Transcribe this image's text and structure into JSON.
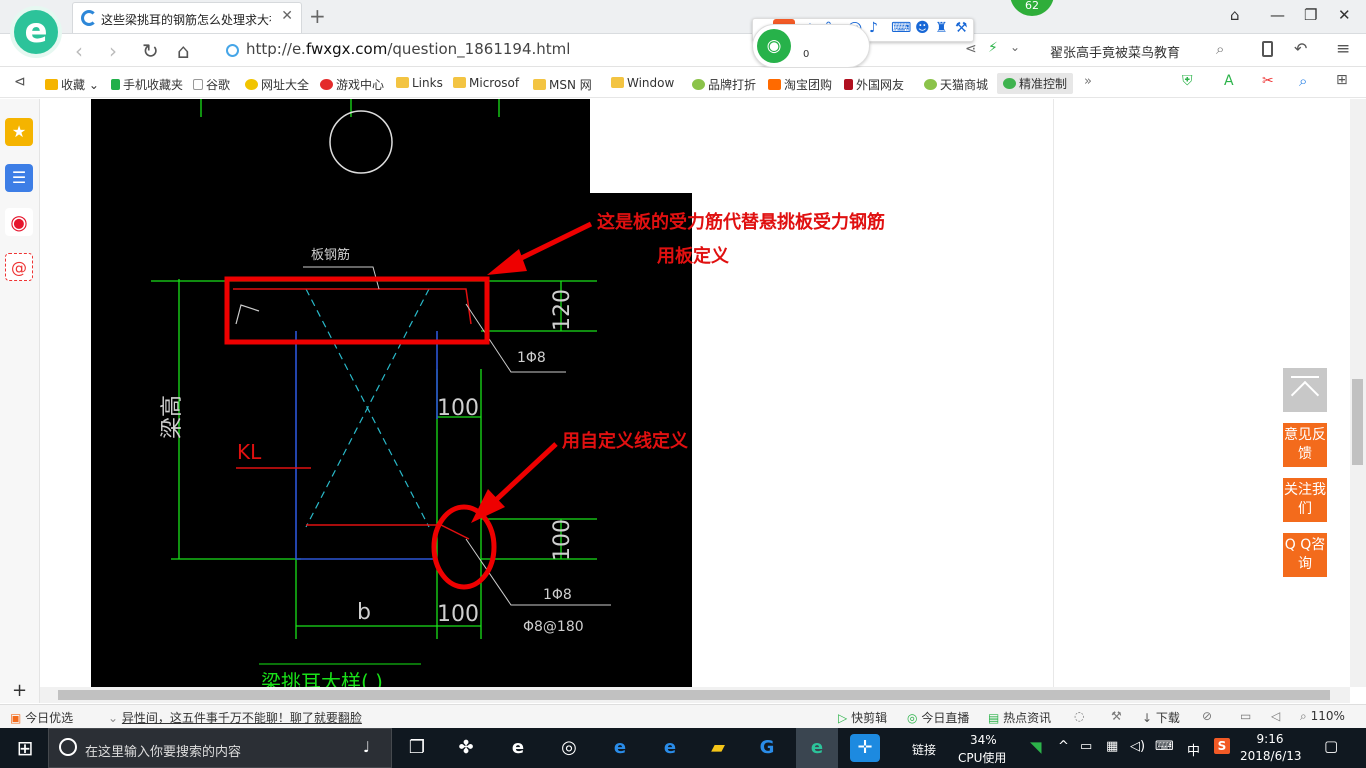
{
  "browser": {
    "tab_title": "这些梁挑耳的钢筋怎么处理求大神",
    "url_prefix": "http://e.",
    "url_domain": "fwxgx.com",
    "url_path": "/question_1861194.html",
    "search_text": "翟张高手竟被菜鸟教育",
    "score_badge": "62",
    "wifi_count": "0",
    "ime_label": "中"
  },
  "bookmarks": [
    "收藏",
    "手机收藏夹",
    "谷歌",
    "网址大全",
    "游戏中心",
    "Links",
    "Microsof",
    "MSN 网",
    "Window",
    "品牌打折",
    "淘宝团购",
    "外国网友",
    "天猫商城",
    "精准控制"
  ],
  "drawing": {
    "label_banjin": "板钢筋",
    "dim_120": "120",
    "dim_100_top": "100",
    "dim_100_right": "100",
    "dim_100_bottom": "100",
    "rebar_1phi8_top": "1Φ8",
    "rebar_1phi8_bottom": "1Φ8",
    "stirrup": "Φ8@180",
    "beam_height": "梁高",
    "kl": "KL",
    "b": "b",
    "bottom_title": "梁挑耳大样( )"
  },
  "annotations": {
    "top_line1": "这是板的受力筋代替悬挑板受力钢筋",
    "top_line2": "用板定义",
    "middle": "用自定义线定义"
  },
  "float_buttons": {
    "feedback": "意见反馈",
    "follow": "关注我们",
    "qq": "Q Q咨询"
  },
  "status_bar": {
    "today": "今日优选",
    "news": "异性间，这五件事千万不能聊！聊了就要翻脸",
    "kuaijianji": "快剪辑",
    "live": "今日直播",
    "hot": "热点资讯",
    "download": "下载",
    "zoom": "110%"
  },
  "taskbar": {
    "search_placeholder": "在这里输入你要搜索的内容",
    "link": "链接",
    "cpu_percent": "34%",
    "cpu_label": "CPU使用",
    "ime": "中",
    "time": "9:16",
    "date": "2018/6/13"
  },
  "colors": {
    "accent_green": "#2cc39a",
    "annotation_red": "#e01010",
    "float_orange": "#f36b1c",
    "cad_green": "#19e019"
  }
}
